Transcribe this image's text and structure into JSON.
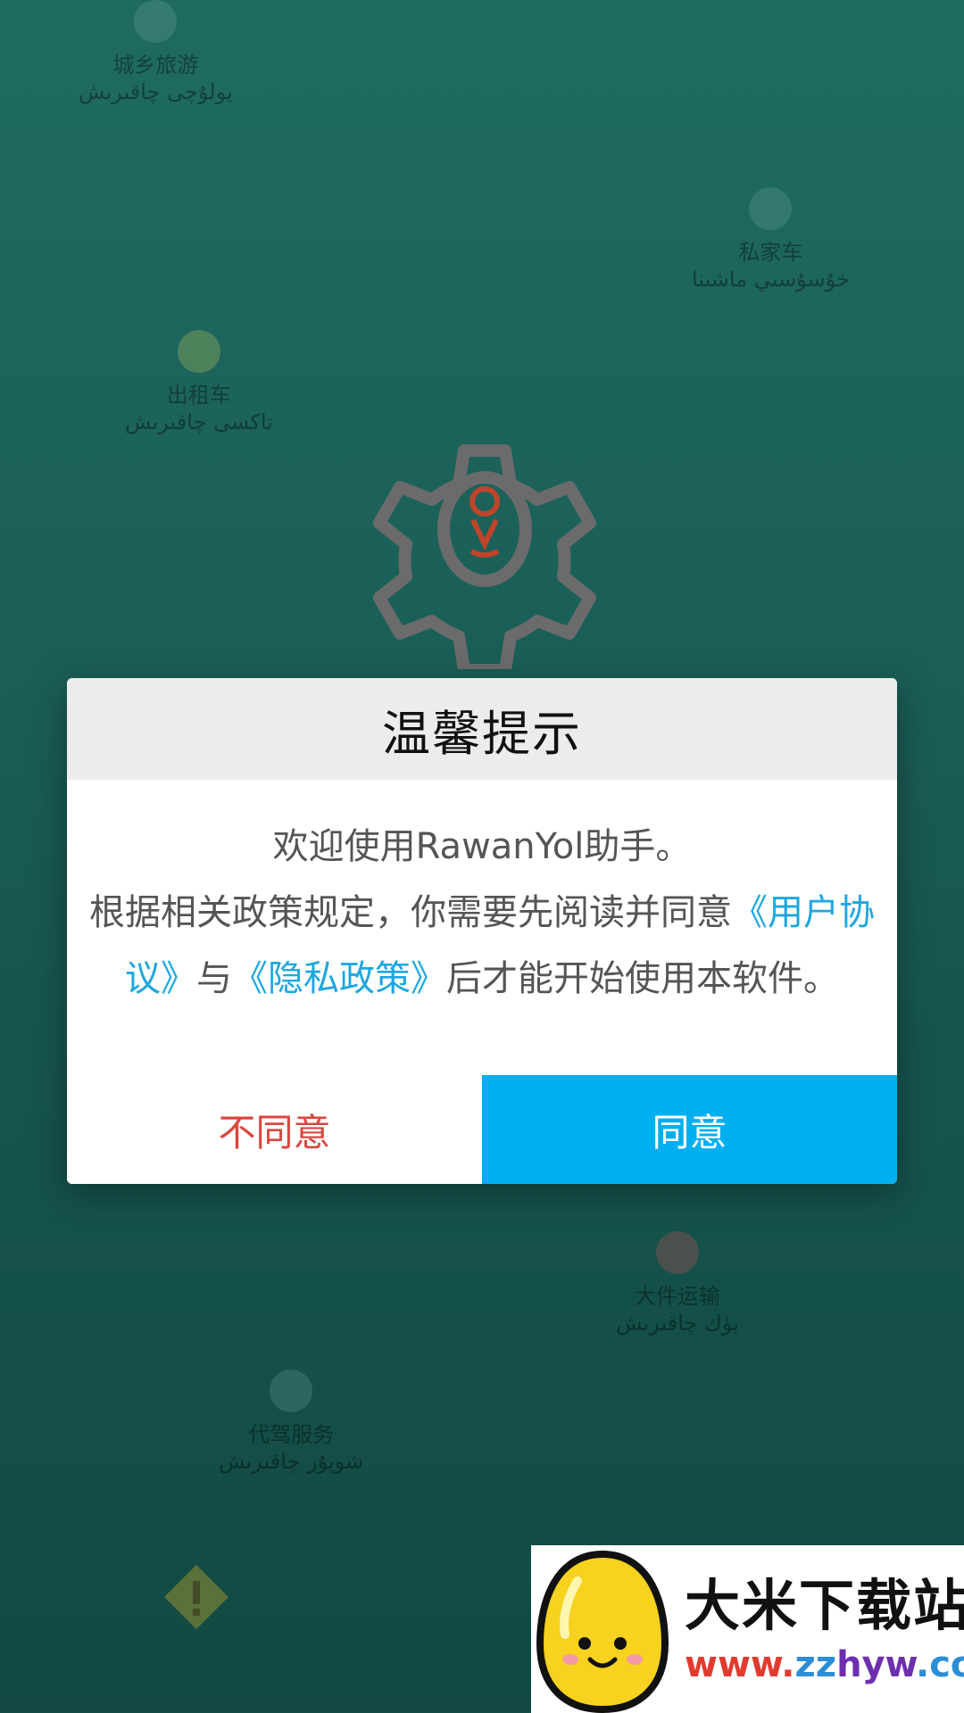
{
  "background": {
    "items": [
      {
        "label": "城乡旅游",
        "sub": "يولۇچى چاقىرىش"
      },
      {
        "label": "私家车",
        "sub": "خۇسۇسىي ماشىنا"
      },
      {
        "label": "出租车",
        "sub": "تاكسى چاقىرىش"
      },
      {
        "label": "大件运输",
        "sub": "يۈك چاقىرىش"
      },
      {
        "label": "代驾服务",
        "sub": "شوپۇر چاقىرىش"
      }
    ]
  },
  "dialog": {
    "title": "温馨提示",
    "line1": "欢迎使用RawanYol助手。",
    "line2_prefix": "根据相关政策规定，你需要先阅读并同意",
    "user_agreement": "《用户协议》",
    "conjunction": "与",
    "privacy_policy": "《隐私政策》",
    "line2_suffix": "后才能开始使用本软件。",
    "disagree_label": "不同意",
    "agree_label": "同意"
  },
  "watermark": {
    "title": "大米下载站",
    "url": "www.zzhyw.com"
  },
  "colors": {
    "background": "#1b6058",
    "header_bg": "#ececec",
    "link": "#1ea7e0",
    "disagree": "#d9473f",
    "agree_bg": "#00aff0"
  },
  "icons": [
    "gear-location-icon",
    "warning-icon",
    "watermark-logo-icon"
  ]
}
